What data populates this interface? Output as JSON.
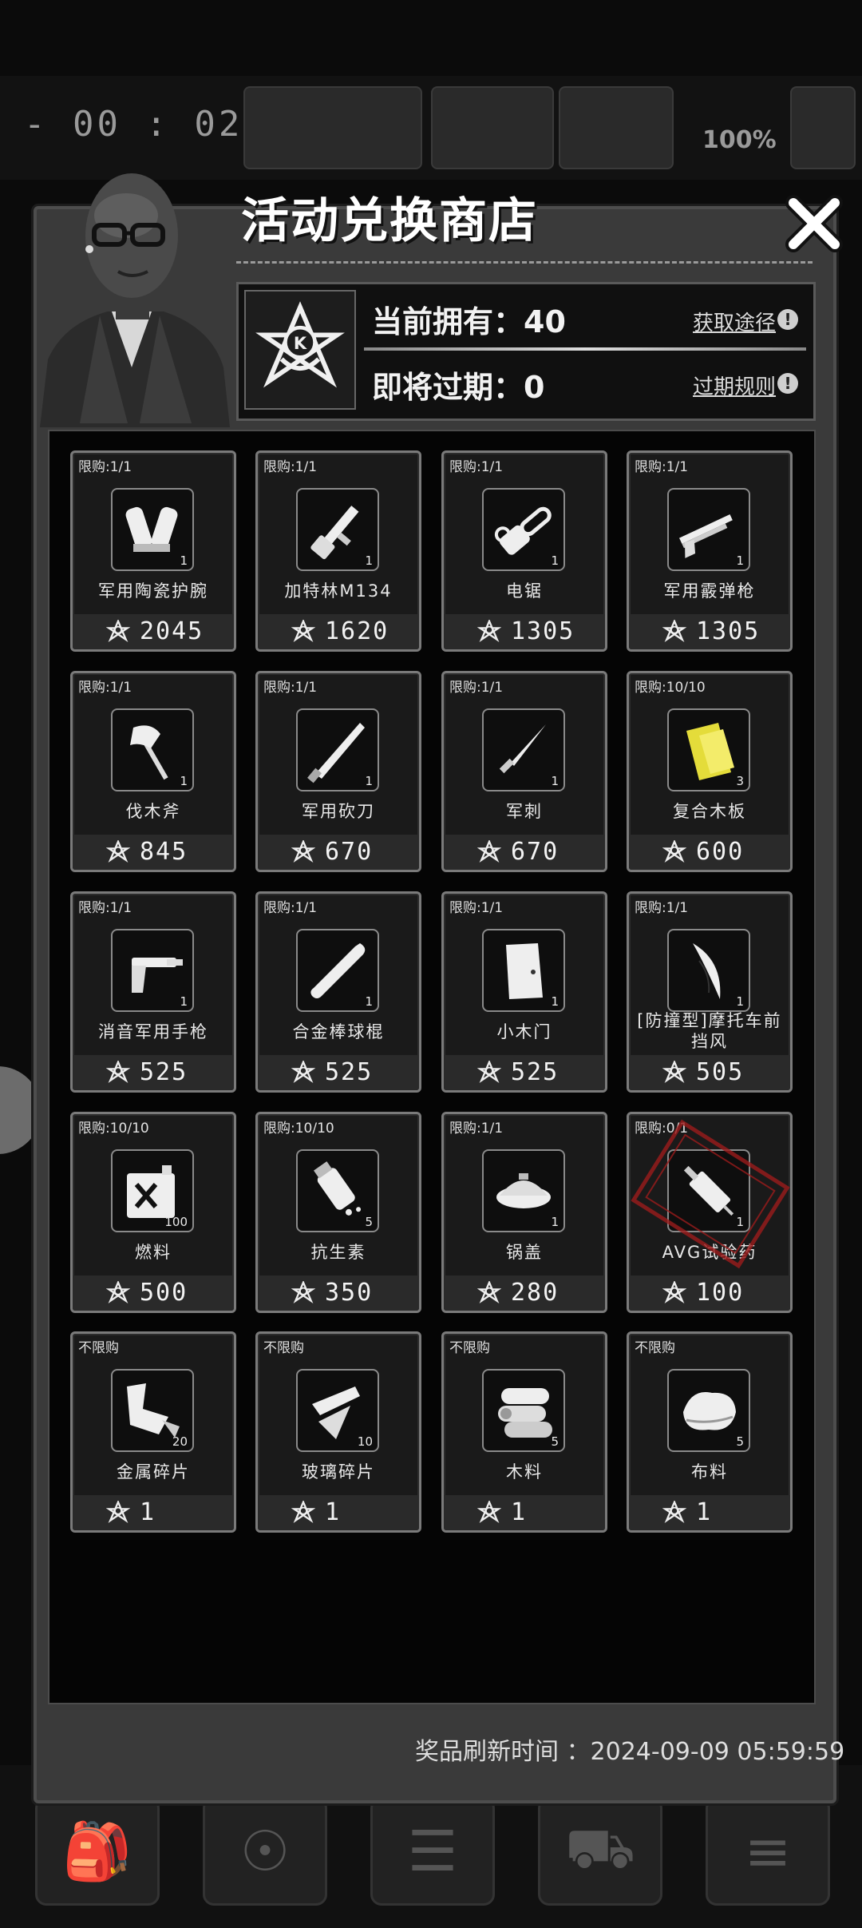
{
  "hud": {
    "timer": "- 00 : 02 -",
    "battery": "100%"
  },
  "shop": {
    "title": "活动兑换商店",
    "owned_label": "当前拥有：40",
    "expiring_label": "即将过期：0",
    "get_link": "获取途径",
    "expire_rule_link": "过期规则",
    "refresh_label": "奖品刷新时间 ：2024-09-09 05:59:59"
  },
  "items": [
    {
      "limit": "限购:1/1",
      "name": "军用陶瓷护腕",
      "qty": "1",
      "price": "2045",
      "icon": "arm-guard-icon"
    },
    {
      "limit": "限购:1/1",
      "name": "加特林M134",
      "qty": "1",
      "price": "1620",
      "icon": "gatling-gun-icon"
    },
    {
      "limit": "限购:1/1",
      "name": "电锯",
      "qty": "1",
      "price": "1305",
      "icon": "chainsaw-icon"
    },
    {
      "limit": "限购:1/1",
      "name": "军用霰弹枪",
      "qty": "1",
      "price": "1305",
      "icon": "shotgun-icon"
    },
    {
      "limit": "限购:1/1",
      "name": "伐木斧",
      "qty": "1",
      "price": "845",
      "icon": "axe-icon"
    },
    {
      "limit": "限购:1/1",
      "name": "军用砍刀",
      "qty": "1",
      "price": "670",
      "icon": "machete-icon"
    },
    {
      "limit": "限购:1/1",
      "name": "军刺",
      "qty": "1",
      "price": "670",
      "icon": "bayonet-icon"
    },
    {
      "limit": "限购:10/10",
      "name": "复合木板",
      "qty": "3",
      "price": "600",
      "icon": "plywood-icon"
    },
    {
      "limit": "限购:1/1",
      "name": "消音军用手枪",
      "qty": "1",
      "price": "525",
      "icon": "silenced-pistol-icon"
    },
    {
      "limit": "限购:1/1",
      "name": "合金棒球棍",
      "qty": "1",
      "price": "525",
      "icon": "baseball-bat-icon"
    },
    {
      "limit": "限购:1/1",
      "name": "小木门",
      "qty": "1",
      "price": "525",
      "icon": "wooden-door-icon"
    },
    {
      "limit": "限购:1/1",
      "name": "[防撞型]摩托车前挡风",
      "qty": "1",
      "price": "505",
      "icon": "windshield-icon"
    },
    {
      "limit": "限购:10/10",
      "name": "燃料",
      "qty": "100",
      "price": "500",
      "icon": "fuel-can-icon"
    },
    {
      "limit": "限购:10/10",
      "name": "抗生素",
      "qty": "5",
      "price": "350",
      "icon": "antibiotics-icon"
    },
    {
      "limit": "限购:1/1",
      "name": "锅盖",
      "qty": "1",
      "price": "280",
      "icon": "pot-lid-icon"
    },
    {
      "limit": "限购:0/1",
      "name": "AVG试验药",
      "qty": "1",
      "price": "100",
      "icon": "syringe-icon",
      "sold_out": true
    },
    {
      "limit": "不限购",
      "name": "金属碎片",
      "qty": "20",
      "price": "1",
      "icon": "metal-scrap-icon"
    },
    {
      "limit": "不限购",
      "name": "玻璃碎片",
      "qty": "10",
      "price": "1",
      "icon": "glass-shard-icon"
    },
    {
      "limit": "不限购",
      "name": "木料",
      "qty": "5",
      "price": "1",
      "icon": "lumber-icon"
    },
    {
      "limit": "不限购",
      "name": "布料",
      "qty": "5",
      "price": "1",
      "icon": "cloth-icon"
    }
  ],
  "colors": {
    "panel": "#3a3a3a",
    "card_border": "#7a7a7a",
    "stamp": "#9b1c1c",
    "plywood": "#e4dc3a"
  }
}
